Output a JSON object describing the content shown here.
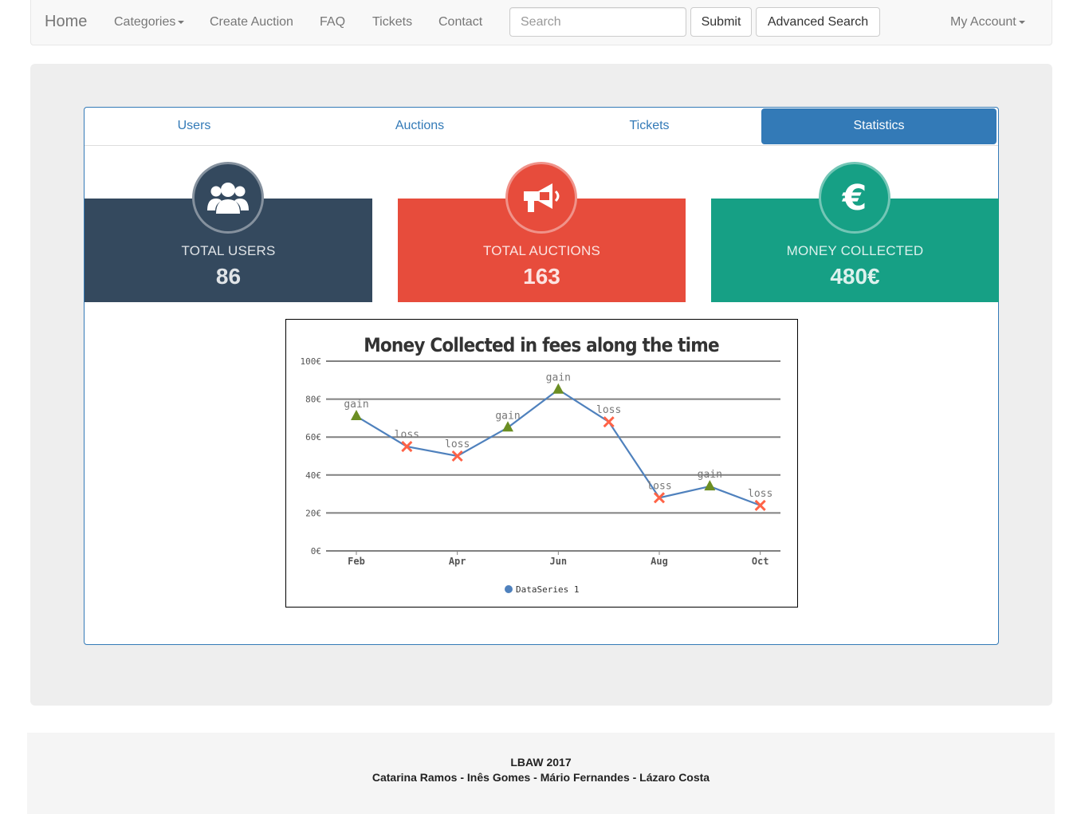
{
  "navbar": {
    "brand": "Home",
    "categories": "Categories",
    "create_auction": "Create Auction",
    "faq": "FAQ",
    "tickets": "Tickets",
    "contact": "Contact",
    "search_placeholder": "Search",
    "submit": "Submit",
    "advanced_search": "Advanced Search",
    "my_account": "My Account"
  },
  "tabs": [
    {
      "label": "Users",
      "active": false
    },
    {
      "label": "Auctions",
      "active": false
    },
    {
      "label": "Tickets",
      "active": false
    },
    {
      "label": "Statistics",
      "active": true
    }
  ],
  "stats": [
    {
      "label": "TOTAL USERS",
      "value": "86",
      "color": "#34495e",
      "icon": "users-icon"
    },
    {
      "label": "TOTAL AUCTIONS",
      "value": "163",
      "color": "#e74c3c",
      "icon": "megaphone-icon"
    },
    {
      "label": "MONEY COLLECTED",
      "value": "480€",
      "color": "#16a085",
      "icon": "euro-icon"
    }
  ],
  "colors": {
    "primary": "#337ab7",
    "gain_marker": "#6b8e23",
    "loss_marker": "#ff6347",
    "line": "#4f81bd"
  },
  "chart_data": {
    "type": "line",
    "title": "Money Collected in fees along the time",
    "x_tick_labels": [
      "Feb",
      "Apr",
      "Jun",
      "Aug",
      "Oct"
    ],
    "y_tick_labels": [
      "0€",
      "20€",
      "40€",
      "60€",
      "80€",
      "100€"
    ],
    "ylim": [
      0,
      100
    ],
    "xlim": [
      1,
      10
    ],
    "grid": true,
    "legend": "bottom",
    "series": [
      {
        "name": "DataSeries 1",
        "points": [
          {
            "x": 1.6,
            "y": 71,
            "label": "gain"
          },
          {
            "x": 2.6,
            "y": 55,
            "label": "loss"
          },
          {
            "x": 3.6,
            "y": 50,
            "label": "loss"
          },
          {
            "x": 4.6,
            "y": 65,
            "label": "gain"
          },
          {
            "x": 5.6,
            "y": 85,
            "label": "gain"
          },
          {
            "x": 6.6,
            "y": 68,
            "label": "loss"
          },
          {
            "x": 7.6,
            "y": 28,
            "label": "loss"
          },
          {
            "x": 8.6,
            "y": 34,
            "label": "gain"
          },
          {
            "x": 9.6,
            "y": 24,
            "label": "loss"
          }
        ]
      }
    ]
  },
  "footer": {
    "title": "LBAW 2017",
    "authors": "Catarina Ramos - Inês Gomes - Mário Fernandes - Lázaro Costa"
  }
}
